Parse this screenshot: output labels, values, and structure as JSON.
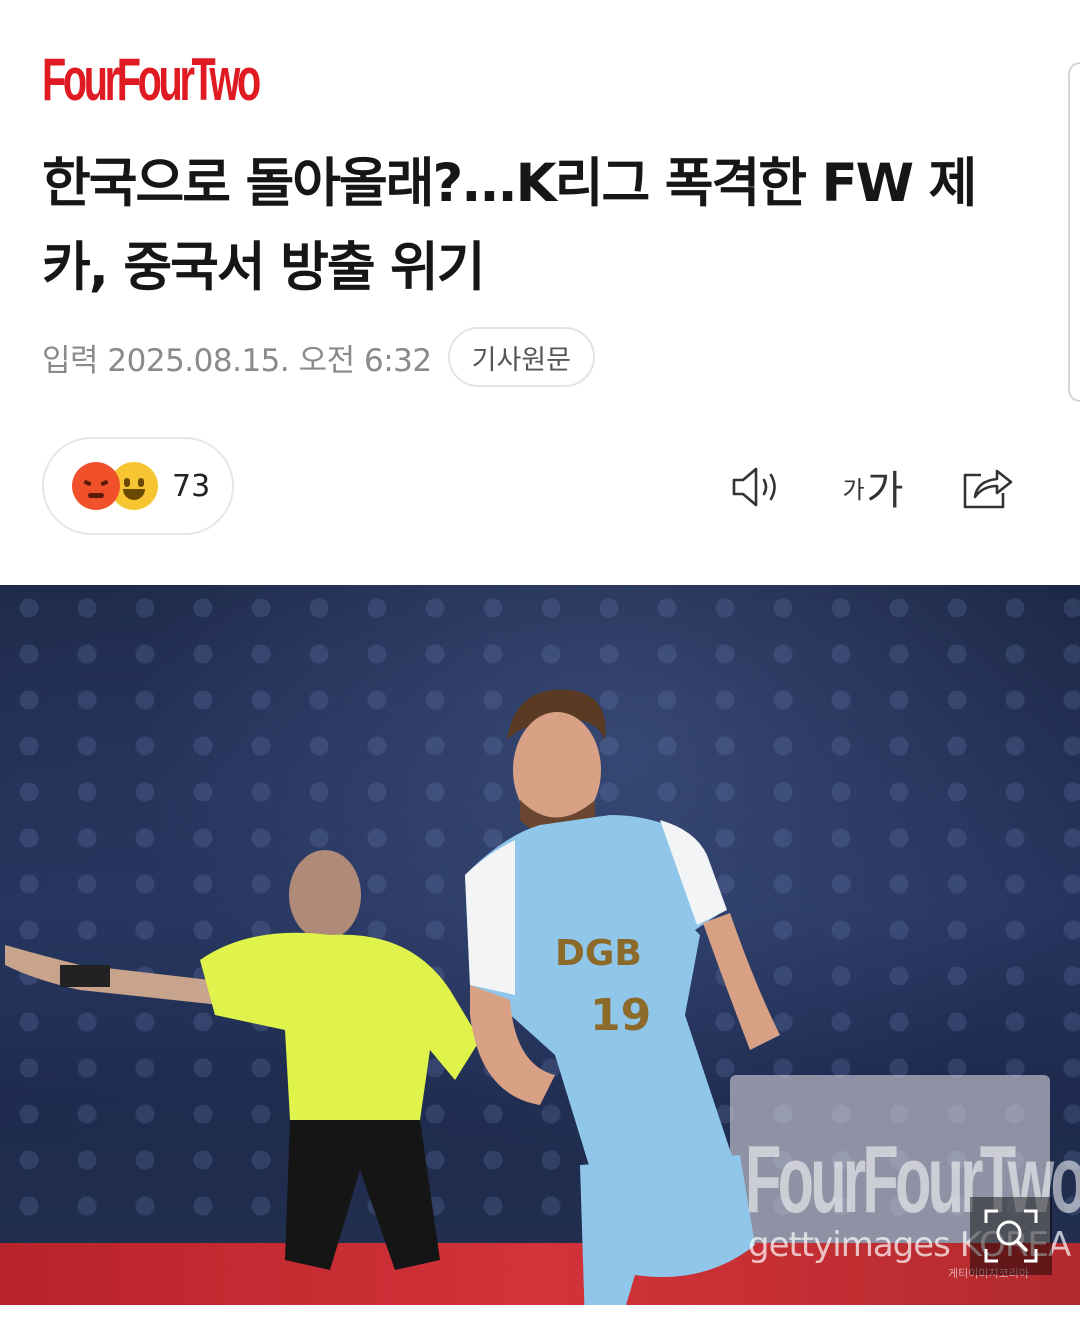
{
  "brand": {
    "logo_text": "FourFourTwo",
    "logo_color": "#e01a22"
  },
  "article": {
    "headline": "한국으로 돌아올래?...K리그 폭격한 FW 제카, 중국서 방출 위기",
    "date": "입력 2025.08.15. 오전 6:32",
    "origin_button": "기사원문"
  },
  "reactions": {
    "icons": [
      "angry-face-icon",
      "laughing-face-icon"
    ],
    "count": "73"
  },
  "toolbar": {
    "tts_icon": "speaker-icon",
    "font_small": "가",
    "font_large": "가",
    "share_icon": "share-icon"
  },
  "photo": {
    "watermark_logo": "FourFourTwo",
    "credit": "gettyimages KOREA",
    "credit_sub": "게티이미지코리아",
    "zoom_icon": "zoom-icon"
  }
}
